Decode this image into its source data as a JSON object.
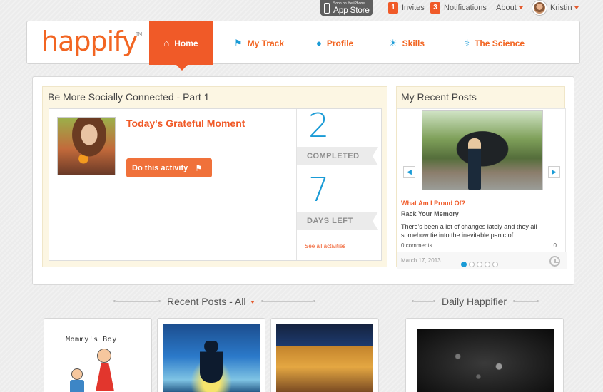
{
  "topbar": {
    "appstore_small": "Soon on the iPhone",
    "appstore_big": "App Store",
    "invites_count": "1",
    "invites_label": "Invites",
    "notifications_count": "3",
    "notifications_label": "Notifications",
    "about_label": "About",
    "user_name": "Kristin"
  },
  "brand": {
    "logo": "happify",
    "tm": "TM",
    "accent": "#f05a28",
    "blue": "#1a9bd6"
  },
  "nav": [
    {
      "label": "Home",
      "icon": "home-icon"
    },
    {
      "label": "My Track",
      "icon": "flag-icon"
    },
    {
      "label": "Profile",
      "icon": "person-icon"
    },
    {
      "label": "Skills",
      "icon": "sun-icon"
    },
    {
      "label": "The Science",
      "icon": "flask-icon"
    }
  ],
  "activity": {
    "title": "Be More Socially Connected - Part 1",
    "moment_title": "Today's Grateful Moment",
    "button_label": "Do this activity",
    "completed_value": "2",
    "completed_label": "COMPLETED",
    "days_value": "7",
    "days_label": "DAYS LEFT",
    "see_all": "See all activities"
  },
  "recent_posts_panel": {
    "title": "My Recent Posts",
    "post_title": "What Am I Proud Of?",
    "post_subtitle": "Rack Your Memory",
    "post_body": "There's been a lot of changes lately and they all somehow tie into the inevitable panic of...",
    "comments": "0 comments",
    "count": "0",
    "date": "March 17, 2013",
    "slides": 5,
    "active_slide": 1
  },
  "lower": {
    "recent_header": "Recent Posts - All",
    "daily_header": "Daily Happifier",
    "tile1_caption": "Mommy's Boy"
  }
}
